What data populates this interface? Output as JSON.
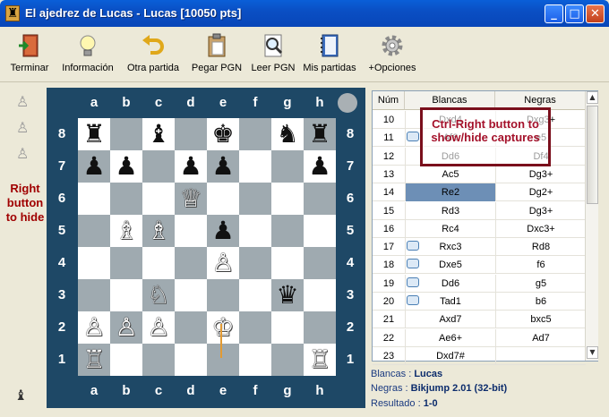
{
  "window": {
    "title": "El ajedrez de Lucas - Lucas [10050 pts]",
    "buttons": {
      "minimize": "_",
      "maximize": "□",
      "close": "✕"
    }
  },
  "toolbar": {
    "items": [
      {
        "label": "Terminar",
        "icon": "exit-door-icon"
      },
      {
        "label": "Información",
        "icon": "lightbulb-icon"
      },
      {
        "label": "Otra partida",
        "icon": "undo-arrow-icon"
      },
      {
        "label": "Pegar PGN",
        "icon": "clipboard-icon"
      },
      {
        "label": "Leer PGN",
        "icon": "magnifier-icon"
      },
      {
        "label": "Mis partidas",
        "icon": "notebook-icon"
      },
      {
        "label": "+Opciones",
        "icon": "gear-icon"
      }
    ]
  },
  "side": {
    "note": "Right button to hide",
    "captured": [
      "♙",
      "♙",
      "♙"
    ]
  },
  "board": {
    "files": [
      "a",
      "b",
      "c",
      "d",
      "e",
      "f",
      "g",
      "h"
    ],
    "ranks": [
      "8",
      "7",
      "6",
      "5",
      "4",
      "3",
      "2",
      "1"
    ],
    "pieces": [
      {
        "sq": "a8",
        "glyph": "♜",
        "color": "b"
      },
      {
        "sq": "c8",
        "glyph": "♝",
        "color": "b"
      },
      {
        "sq": "e8",
        "glyph": "♚",
        "color": "b"
      },
      {
        "sq": "g8",
        "glyph": "♞",
        "color": "b"
      },
      {
        "sq": "h8",
        "glyph": "♜",
        "color": "b"
      },
      {
        "sq": "a7",
        "glyph": "♟",
        "color": "b"
      },
      {
        "sq": "b7",
        "glyph": "♟",
        "color": "b"
      },
      {
        "sq": "d7",
        "glyph": "♟",
        "color": "b"
      },
      {
        "sq": "e7",
        "glyph": "♟",
        "color": "b"
      },
      {
        "sq": "h7",
        "glyph": "♟",
        "color": "b"
      },
      {
        "sq": "e5",
        "glyph": "♟",
        "color": "b"
      },
      {
        "sq": "g3",
        "glyph": "♛",
        "color": "b"
      },
      {
        "sq": "d6",
        "glyph": "♕",
        "color": "w"
      },
      {
        "sq": "b5",
        "glyph": "♗",
        "color": "w"
      },
      {
        "sq": "c5",
        "glyph": "♗",
        "color": "w"
      },
      {
        "sq": "e4",
        "glyph": "♙",
        "color": "w"
      },
      {
        "sq": "c3",
        "glyph": "♘",
        "color": "w"
      },
      {
        "sq": "a2",
        "glyph": "♙",
        "color": "w"
      },
      {
        "sq": "b2",
        "glyph": "♙",
        "color": "w"
      },
      {
        "sq": "c2",
        "glyph": "♙",
        "color": "w"
      },
      {
        "sq": "e2",
        "glyph": "♔",
        "color": "w"
      },
      {
        "sq": "a1",
        "glyph": "♖",
        "color": "w"
      },
      {
        "sq": "h1",
        "glyph": "♖",
        "color": "w"
      }
    ]
  },
  "moves": {
    "headers": {
      "num": "Núm",
      "white": "Blancas",
      "black": "Negras"
    },
    "rows": [
      {
        "n": "10",
        "w": "Dxd4",
        "b": "Dxg3+",
        "comment": false,
        "sel": false
      },
      {
        "n": "11",
        "w": "Af6",
        "b": "e5",
        "comment": true,
        "sel": false
      },
      {
        "n": "12",
        "w": "Dd6",
        "b": "Df4",
        "comment": false,
        "sel": false
      },
      {
        "n": "13",
        "w": "Ac5",
        "b": "Dg3+",
        "comment": false,
        "sel": false
      },
      {
        "n": "14",
        "w": "Re2",
        "b": "Dg2+",
        "comment": false,
        "sel": true
      },
      {
        "n": "15",
        "w": "Rd3",
        "b": "Dg3+",
        "comment": false,
        "sel": false
      },
      {
        "n": "16",
        "w": "Rc4",
        "b": "Dxc3+",
        "comment": false,
        "sel": false
      },
      {
        "n": "17",
        "w": "Rxc3",
        "b": "Rd8",
        "comment": true,
        "sel": false
      },
      {
        "n": "18",
        "w": "Dxe5",
        "b": "f6",
        "comment": true,
        "sel": false
      },
      {
        "n": "19",
        "w": "Dd6",
        "b": "g5",
        "comment": true,
        "sel": false
      },
      {
        "n": "20",
        "w": "Tad1",
        "b": "b6",
        "comment": true,
        "sel": false
      },
      {
        "n": "21",
        "w": "Axd7",
        "b": "bxc5",
        "comment": false,
        "sel": false
      },
      {
        "n": "22",
        "w": "Ae6+",
        "b": "Ad7",
        "comment": false,
        "sel": false
      },
      {
        "n": "23",
        "w": "Dxd7#",
        "b": "",
        "comment": false,
        "sel": false
      }
    ]
  },
  "tooltip": {
    "text": "Ctrl-Right button to show/hide captures"
  },
  "game_info": {
    "white_label": "Blancas :",
    "white": "Lucas",
    "black_label": "Negras :",
    "black": "Bikjump 2.01 (32-bit)",
    "result_label": "Resultado :",
    "result": "1-0"
  },
  "colors": {
    "frame": "#1e4866",
    "dark_square": "#9faab0",
    "light_square": "#ffffff",
    "selected_move": "#6d8fb6",
    "accent_red": "#a00000"
  }
}
